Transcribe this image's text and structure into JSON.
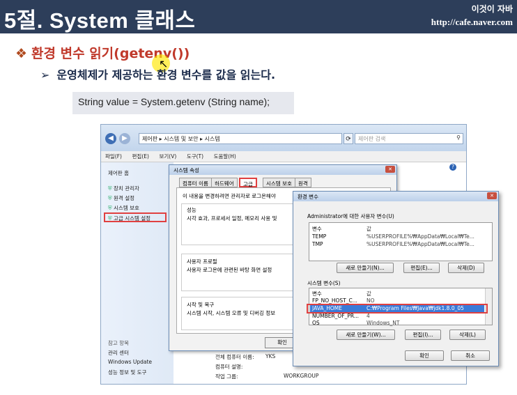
{
  "slide": {
    "title": "5절. System 클래스",
    "brand": "이것이 자바",
    "url": "http://cafe.naver.com",
    "bullet1": "환경 변수 읽기(getenv())",
    "bullet1_mark": "❖",
    "bullet2": "운영체제가 제공하는 환경 변수를 값을 읽는다.",
    "bullet2_mark": "➢",
    "code": "String value = System.getenv (String name);"
  },
  "window": {
    "address": "제어판 ▸ 시스템 및 보안 ▸ 시스템",
    "search_placeholder": "제어판 검색",
    "menu": [
      "파일(F)",
      "편집(E)",
      "보기(V)",
      "도구(T)",
      "도움말(H)"
    ],
    "sidebar_home": "제어판 홈",
    "sidebar_items": [
      "장치 관리자",
      "원격 설정",
      "시스템 보호",
      "고급 시스템 설정"
    ],
    "see_also": "참고 항목",
    "see_also_items": [
      "관리 센터",
      "Windows Update",
      "성능 정보 및 도구"
    ],
    "bottom_rows": [
      {
        "label": "전체 컴퓨터 이름:",
        "value": "YKS"
      },
      {
        "label": "컴퓨터 설명:",
        "value": ""
      },
      {
        "label": "작업 그룹:",
        "value": "WORKGROUP"
      }
    ]
  },
  "sysprops": {
    "title": "시스템 속성",
    "tabs": [
      "컴퓨터 이름",
      "하드웨어",
      "고급",
      "시스템 보호",
      "원격"
    ],
    "admin_note": "이 내용을 변경하려면 관리자로 로그온해야",
    "perf_title": "성능",
    "perf_text": "시각 효과, 프로세서 일정, 메모리 사용 및",
    "profile_title": "사용자 프로필",
    "profile_text": "사용자 로그온에 관련된 바탕 화면 설정",
    "startup_title": "시작 및 복구",
    "startup_text": "시스템 시작, 시스템 오류 및 디버깅 정보",
    "ok": "확인"
  },
  "envvars": {
    "title": "환경 변수",
    "user_section": "Administrator에 대한 사용자 변수(U)",
    "col_var": "변수",
    "col_val": "값",
    "user_vars": [
      {
        "name": "TEMP",
        "value": "%USERPROFILE%₩AppData₩Local₩Te..."
      },
      {
        "name": "TMP",
        "value": "%USERPROFILE%₩AppData₩Local₩Te..."
      }
    ],
    "user_buttons": [
      "새로 만들기(N)...",
      "편집(E)...",
      "삭제(D)"
    ],
    "sys_section": "시스템 변수(S)",
    "sys_vars": [
      {
        "name": "FP_NO_HOST_C...",
        "value": "NO"
      },
      {
        "name": "JAVA_HOME",
        "value": "C:₩Program Files₩Java₩jdk1.8.0_05"
      },
      {
        "name": "NUMBER_OF_PR...",
        "value": "4"
      },
      {
        "name": "OS",
        "value": "Windows_NT"
      }
    ],
    "sys_buttons": [
      "새로 만들기(W)...",
      "편집(I)...",
      "삭제(L)"
    ],
    "ok": "확인",
    "cancel": "취소"
  }
}
